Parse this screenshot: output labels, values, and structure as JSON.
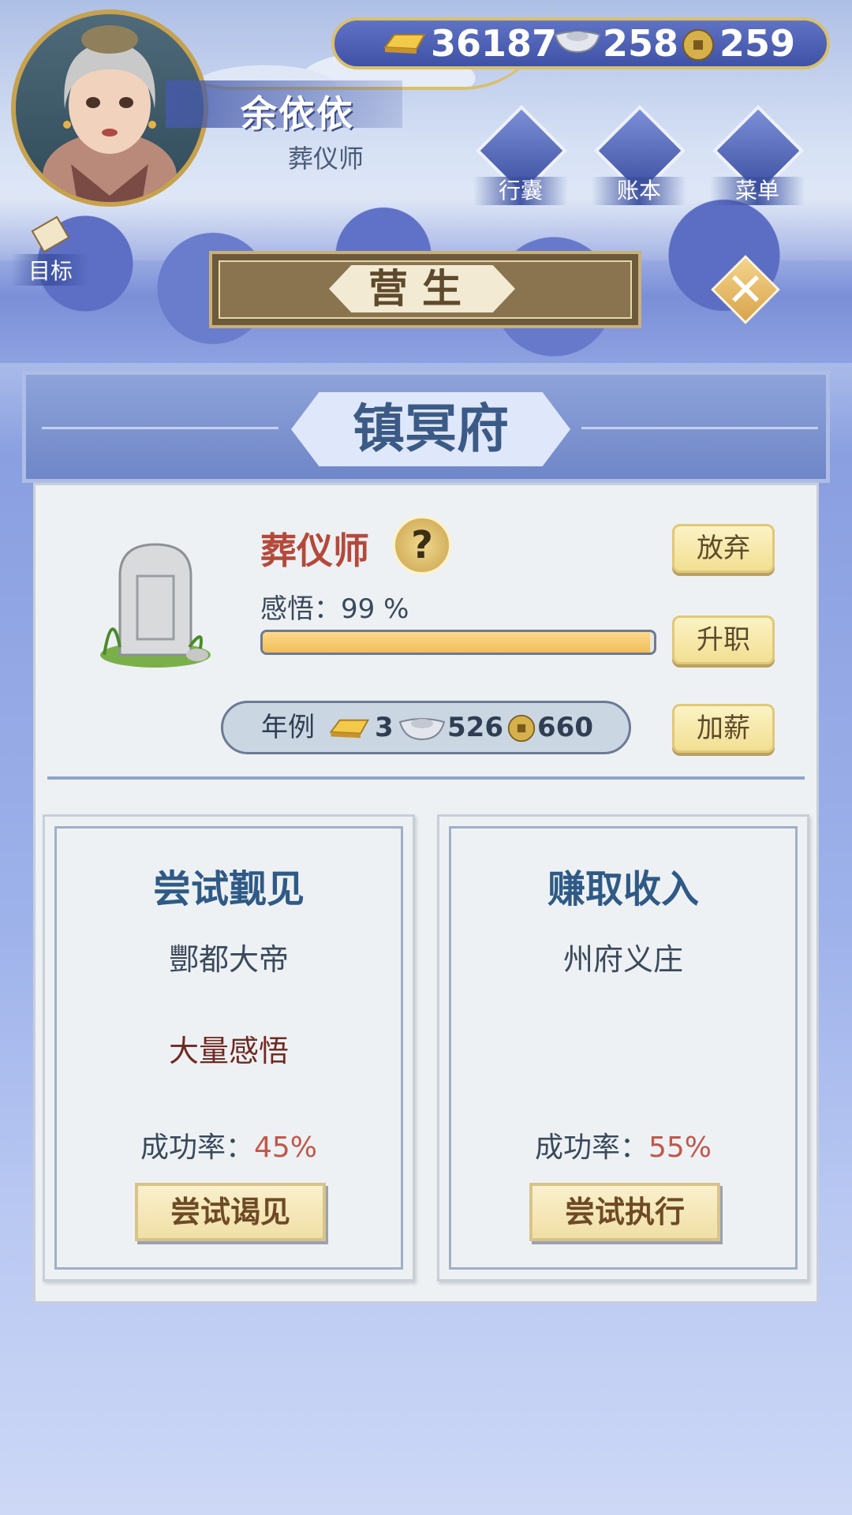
{
  "resources": {
    "gold": "36187",
    "silver": "258",
    "coins": "259"
  },
  "player": {
    "name": "余依依",
    "title": "葬仪师"
  },
  "menu": [
    {
      "label": "行囊",
      "icon": "bag-icon"
    },
    {
      "label": "账本",
      "icon": "ledger-icon"
    },
    {
      "label": "菜单",
      "icon": "more-icon"
    }
  ],
  "goal": {
    "label": "目标",
    "icon": "scroll-icon"
  },
  "page": {
    "banner": "营生",
    "close_icon": "close-icon"
  },
  "panel": {
    "location": "镇冥府",
    "job": {
      "name": "葬仪师",
      "help": "?",
      "insight_label": "感悟：99 %",
      "insight_progress": 0.99,
      "buttons": {
        "abandon": "放弃",
        "promote": "升职",
        "raise": "加薪"
      },
      "salary": {
        "label": "年例",
        "gold": "3",
        "silver": "526",
        "coins": "660"
      }
    },
    "cards": [
      {
        "title": "尝试觐见",
        "subtitle": "酆都大帝",
        "reward": "大量感悟",
        "rate_label": "成功率：",
        "rate_value": "45%",
        "button": "尝试谒见"
      },
      {
        "title": "赚取收入",
        "subtitle": "州府义庄",
        "reward": "",
        "rate_label": "成功率：",
        "rate_value": "55%",
        "button": "尝试执行"
      }
    ]
  },
  "colors": {
    "accent_gold": "#d9c06a",
    "progress_fill": "#f1be5a",
    "job_name": "#b4493b",
    "rate_value": "#c0584a",
    "title_blue": "#2f5a86"
  }
}
